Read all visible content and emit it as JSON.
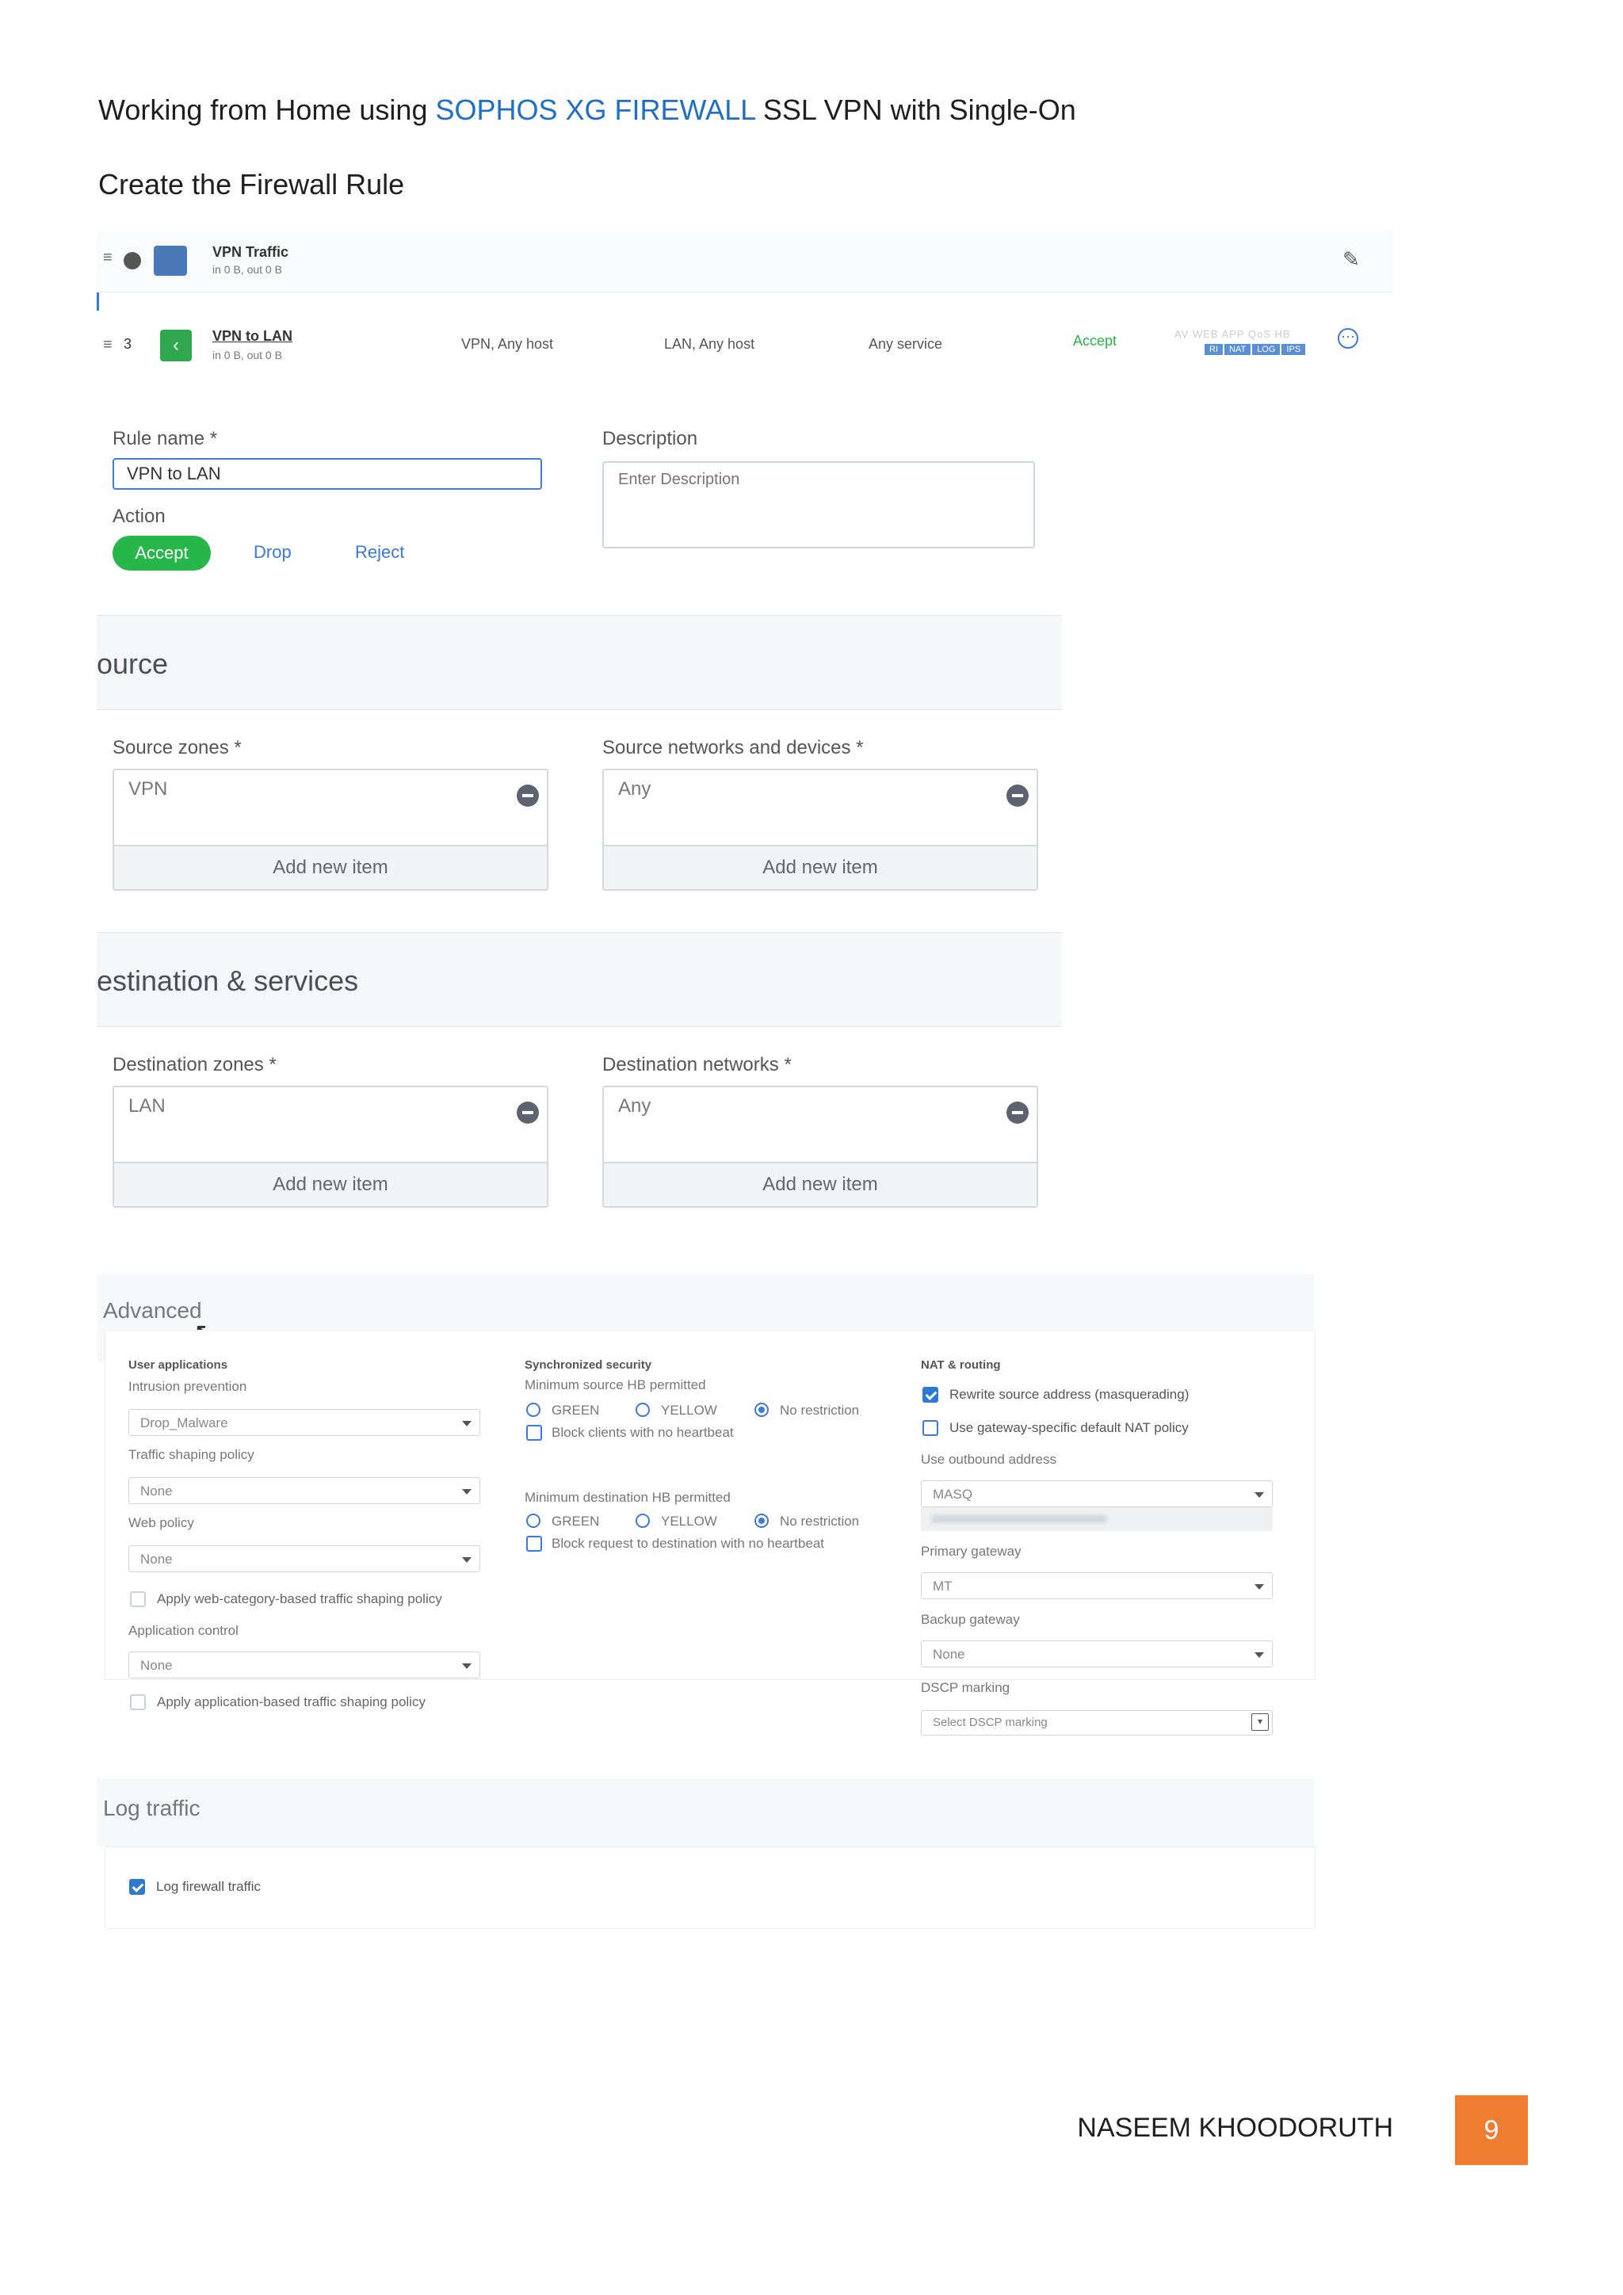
{
  "document": {
    "heading": {
      "prefix": "Working from Home using ",
      "brand": "SOPHOS XG FIREWALL",
      "suffix": " SSL VPN with Single-On"
    },
    "subheading": "Create the Firewall Rule",
    "footer_name": "NASEEM KHOODORUTH",
    "page_number": "9"
  },
  "colors": {
    "brand_blue": "#1f6fc3",
    "accept_green": "#27b64a",
    "page_badge": "#ee7d31",
    "check_blue": "#2e7ad0"
  },
  "rule_list": {
    "group_row": {
      "name": "VPN Traffic",
      "stats": "in 0 B, out 0 B",
      "edit_icon": "pencil-icon"
    },
    "rule_row": {
      "number": "3",
      "name": "VPN to LAN",
      "stats": "in 0 B, out 0 B",
      "source": "VPN, Any host",
      "destination": "LAN, Any host",
      "service": "Any service",
      "action": "Accept",
      "tags_top": "AV WEB APP QoS HB",
      "tags_bottom": [
        "RI",
        "NAT",
        "LOG",
        "IPS"
      ],
      "more_icon": "more-options-icon"
    }
  },
  "form": {
    "rule_name_label": "Rule name *",
    "rule_name_value": "VPN to LAN",
    "description_label": "Description",
    "description_placeholder": "Enter Description",
    "action_label": "Action",
    "action_accept": "Accept",
    "action_drop": "Drop",
    "action_reject": "Reject"
  },
  "source_section": {
    "title": "ource",
    "zones_label": "Source zones *",
    "zones_value": "VPN",
    "zones_add": "Add new item",
    "networks_label": "Source networks and devices *",
    "networks_value": "Any",
    "networks_add": "Add new item"
  },
  "destination_section": {
    "title": "estination & services",
    "zones_label": "Destination zones *",
    "zones_value": "LAN",
    "zones_add": "Add new item",
    "networks_label": "Destination networks *",
    "networks_value": "Any",
    "networks_add": "Add new item"
  },
  "advanced": {
    "title": "Advanced",
    "user_apps": {
      "heading": "User applications",
      "ips_label": "Intrusion prevention",
      "ips_value": "Drop_Malware",
      "traffic_label": "Traffic shaping policy",
      "traffic_value": "None",
      "web_label": "Web policy",
      "web_value": "None",
      "web_shaping": "Apply web-category-based traffic shaping policy",
      "app_label": "Application control",
      "app_value": "None",
      "app_shaping": "Apply application-based traffic shaping policy"
    },
    "sync_security": {
      "heading": "Synchronized security",
      "min_source_label": "Minimum source HB permitted",
      "green": "GREEN",
      "yellow": "YELLOW",
      "no_restriction": "No restriction",
      "block_clients": "Block clients with no heartbeat",
      "min_dest_label": "Minimum destination HB permitted",
      "green2": "GREEN",
      "yellow2": "YELLOW",
      "no_restriction2": "No restriction",
      "block_request": "Block request to destination with no heartbeat"
    },
    "nat_routing": {
      "heading": "NAT & routing",
      "rewrite": "Rewrite source address (masquerading)",
      "gateway_nat": "Use gateway-specific default NAT policy",
      "outbound_label": "Use outbound address",
      "outbound_value": "MASQ",
      "primary_label": "Primary gateway",
      "primary_value": "MT",
      "backup_label": "Backup gateway",
      "backup_value": "None",
      "dscp_label": "DSCP marking",
      "dscp_value": "Select DSCP marking"
    }
  },
  "log_traffic": {
    "title": "Log traffic",
    "checkbox_label": "Log firewall traffic"
  }
}
